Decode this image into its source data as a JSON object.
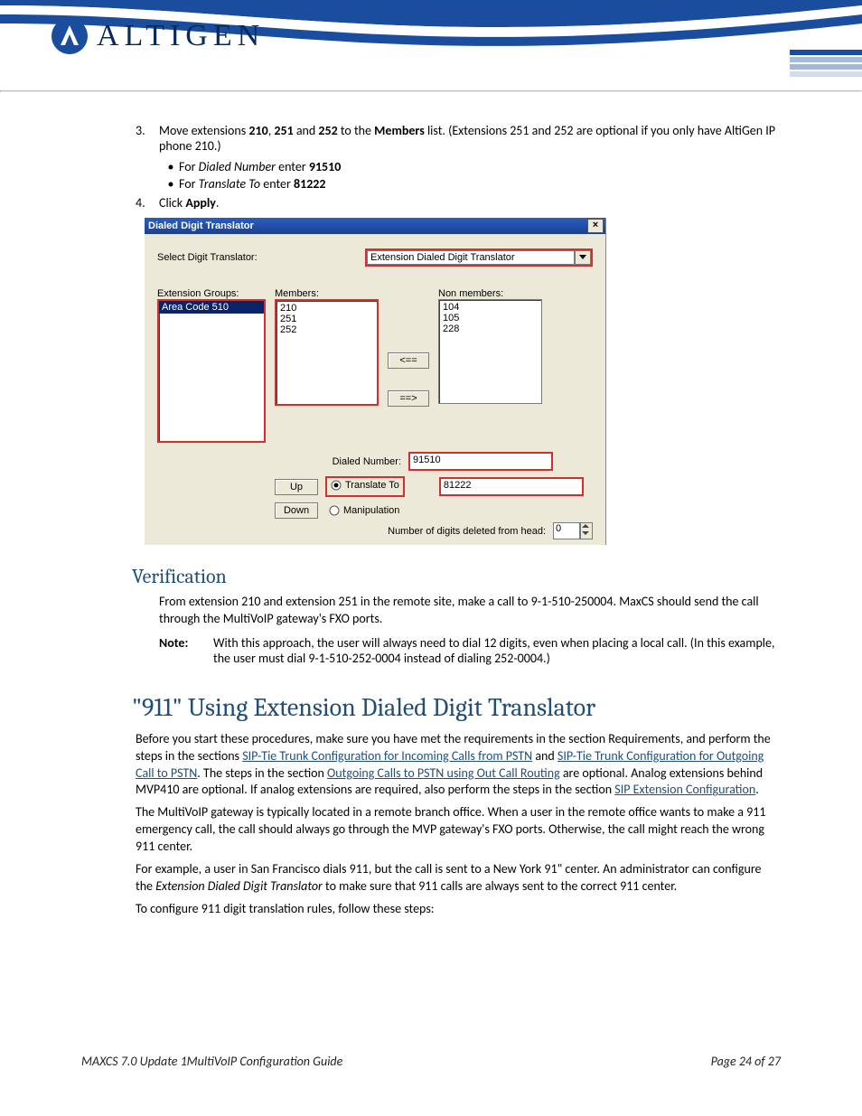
{
  "header": {
    "brand": "ALTIGEN"
  },
  "steps": {
    "s3_num": "3.",
    "s3_text_a": "Move extensions ",
    "s3_b1": "210",
    "s3_t2": ", ",
    "s3_b2": "251",
    "s3_t3": " and ",
    "s3_b3": "252",
    "s3_t4": " to the ",
    "s3_b4": "Members",
    "s3_t5": " list. (Extensions 251 and 252 are optional if you only have AltiGen IP phone 210.)",
    "bullet1_a": "For ",
    "bullet1_i": "Dialed Number",
    "bullet1_b": " enter ",
    "bullet1_v": "91510",
    "bullet2_a": "For ",
    "bullet2_i": "Translate To",
    "bullet2_b": " enter ",
    "bullet2_v": "81222",
    "s4_num": "4.",
    "s4_text_a": "Click ",
    "s4_b": "Apply",
    "s4_text_c": "."
  },
  "dialog": {
    "title": "Dialed Digit Translator",
    "select_label": "Select Digit Translator:",
    "select_value": "Extension Dialed Digit Translator",
    "ext_groups_label": "Extension Groups:",
    "members_label": "Members:",
    "nonmembers_label": "Non members:",
    "ext_groups": [
      "Area Code 510"
    ],
    "members": [
      "210",
      "251",
      "252"
    ],
    "nonmembers": [
      "104",
      "105",
      "228"
    ],
    "move_left": "<==",
    "move_right": "==>",
    "dialed_number_label": "Dialed Number:",
    "dialed_number_value": "91510",
    "up_btn": "Up",
    "down_btn": "Down",
    "translate_radio": "Translate To",
    "translate_value": "81222",
    "manipulation_radio": "Manipulation",
    "digits_deleted_label": "Number of digits deleted from head:",
    "digits_deleted_value": "0"
  },
  "verification": {
    "heading": "Verification",
    "p1": "From extension 210 and extension 251 in the remote site, make a call to 9-1-510-250004. MaxCS should send the call through the MultiVoIP gateway's FXO ports.",
    "note_label": "Note:",
    "note_text": "With this approach, the user will always need to dial 12 digits, even when placing a local call. (In this example, the user must dial 9-1-510-252-0004 instead of dialing 252-0004.)"
  },
  "section911": {
    "heading": "\"911\" Using Extension Dialed Digit Translator",
    "p1a": "Before you start these procedures, make sure you have met the requirements in the section Requirements, and perform the steps in the sections ",
    "link1": "SIP-Tie Trunk Configuration for Incoming Calls from PSTN",
    "p1b": " and ",
    "link2": "SIP-Tie Trunk Configuration for Outgoing Call to PSTN",
    "p1c": ". The steps in the section ",
    "link3": "Outgoing Calls to PSTN using Out Call Routing",
    "p1d": " are optional. Analog extensions behind MVP410 are optional. If analog extensions are required, also perform the steps in the section ",
    "link4": "SIP Extension Configuration",
    "p1e": ".",
    "p2": "The MultiVoIP gateway is typically located in a remote branch office. When a user in the remote office wants to make a 911 emergency call, the call should always go through the MVP gateway's FXO ports. Otherwise, the call might reach the wrong 911 center.",
    "p3a": "For example, a user in San Francisco dials 911, but the call is sent to a New York 91\" center. An administrator can configure the ",
    "p3i": "Extension Dialed Digit Translator",
    "p3b": " to make sure that 911 calls are always sent to the correct 911 center.",
    "p4": "To configure 911 digit translation rules, follow these steps:"
  },
  "footer": {
    "left": "MAXCS 7.0 Update 1MultiVoIP Configuration Guide",
    "right": "Page 24 of 27"
  }
}
